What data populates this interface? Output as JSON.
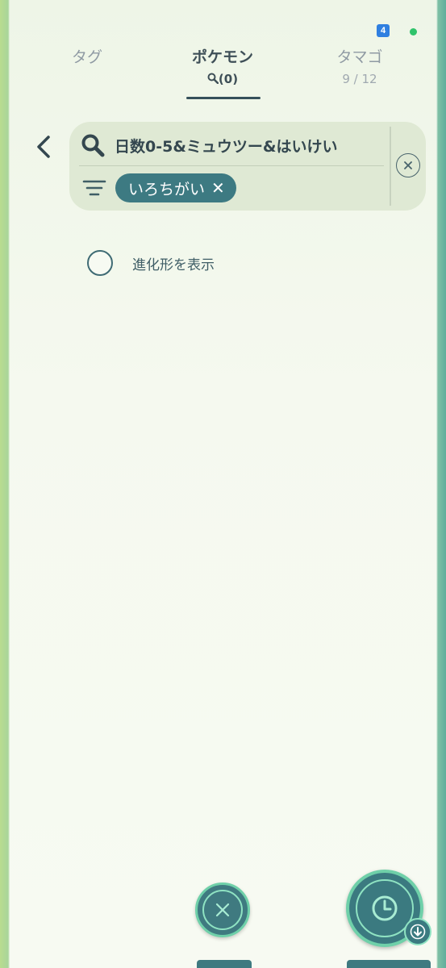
{
  "status_bar": {
    "notification_count": "4"
  },
  "tabs": [
    {
      "label": "タグ",
      "sub": ""
    },
    {
      "label": "ポケモン",
      "sub": "(0)"
    },
    {
      "label": "タマゴ",
      "sub": "9 / 12"
    }
  ],
  "search": {
    "query": "日数0-5&ミュウツー&はいけい",
    "chip_label": "いろちがい",
    "chip_remove": "✕"
  },
  "options": {
    "show_evolutions_label": "進化形を表示"
  },
  "icons": {
    "back": "chevron-left-icon",
    "search": "search-icon",
    "filter": "filter-icon",
    "clear": "clear-icon",
    "close": "close-icon",
    "history": "clock-icon",
    "download": "download-icon"
  },
  "colors": {
    "accent": "#3d7a82",
    "fab_ring": "#6fd0a9",
    "text_dark": "#34474f",
    "search_bg": "#dfe9d4"
  }
}
